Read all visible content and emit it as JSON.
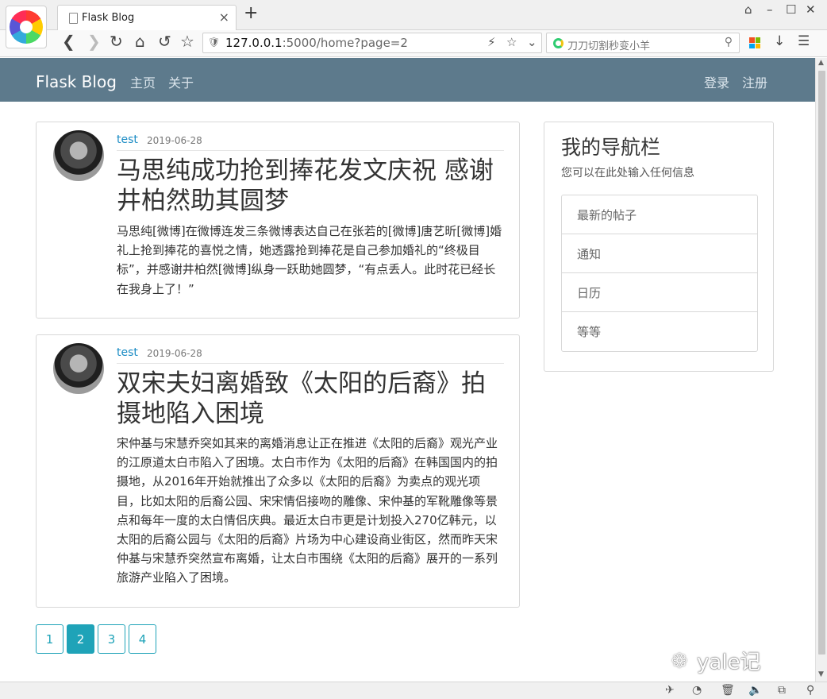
{
  "browser": {
    "tab_title": "Flask Blog",
    "tab_close": "×",
    "new_tab": "+",
    "url_host": "127.0.0.1",
    "url_rest": ":5000/home?page=2",
    "search_placeholder": "刀刀切割秒变小羊"
  },
  "navbar": {
    "brand": "Flask Blog",
    "links": [
      "主页",
      "关于"
    ],
    "login": "登录",
    "register": "注册"
  },
  "posts": [
    {
      "author": "test",
      "date": "2019-06-28",
      "title": "马思纯成功抢到捧花发文庆祝 感谢井柏然助其圆梦",
      "content": "马思纯[微博]在微博连发三条微博表达自己在张若的[微博]唐艺昕[微博]婚礼上抢到捧花的喜悦之情，她透露抢到捧花是自己参加婚礼的“终极目标”，并感谢井柏然[微博]纵身一跃助她圆梦，“有点丢人。此时花已经长在我身上了！”"
    },
    {
      "author": "test",
      "date": "2019-06-28",
      "title": "双宋夫妇离婚致《太阳的后裔》拍摄地陷入困境",
      "content": "宋仲基与宋慧乔突如其来的离婚消息让正在推进《太阳的后裔》观光产业的江原道太白市陷入了困境。太白市作为《太阳的后裔》在韩国国内的拍摄地，从2016年开始就推出了众多以《太阳的后裔》为卖点的观光项目，比如太阳的后裔公园、宋宋情侣接吻的雕像、宋仲基的军靴雕像等景点和每年一度的太白情侣庆典。最近太白市更是计划投入270亿韩元，以太阳的后裔公园与《太阳的后裔》片场为中心建设商业街区，然而昨天宋仲基与宋慧乔突然宣布离婚，让太白市围绕《太阳的后裔》展开的一系列旅游产业陷入了困境。"
    }
  ],
  "sidebar": {
    "title": "我的导航栏",
    "description": "您可以在此处输入任何信息",
    "items": [
      "最新的帖子",
      "通知",
      "日历",
      "等等"
    ]
  },
  "pagination": {
    "pages": [
      "1",
      "2",
      "3",
      "4"
    ],
    "current": "2"
  },
  "watermark": "yale记"
}
